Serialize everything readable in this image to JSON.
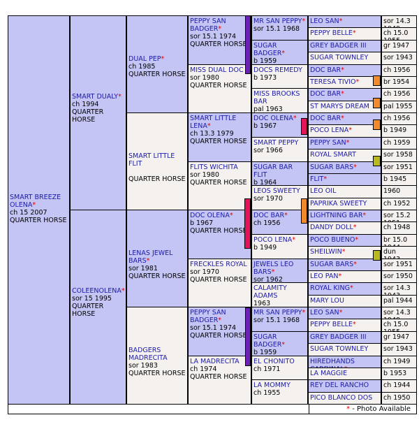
{
  "marker_colors": {
    "purple": "#6e1fb5",
    "red": "#e2145a",
    "orange": "#f08a2c",
    "olive": "#b8b820"
  },
  "footer": {
    "star": "*",
    "legend": " - Photo Available"
  },
  "gen1": {
    "name": "SMART BREEZE OLENA",
    "star": "*",
    "line1": "ch 15 2007",
    "line2": "QUARTER HORSE"
  },
  "gen2": [
    {
      "name": "SMART DUALY",
      "star": "*",
      "line1": "ch 1994",
      "line2": "QUARTER HORSE"
    },
    {
      "name": "COLEENOLENA",
      "star": "*",
      "line1": "sor 15 1995",
      "line2": "QUARTER HORSE"
    }
  ],
  "gen3": [
    {
      "name": "DUAL PEP",
      "star": "*",
      "line1": "ch 1985",
      "line2": "QUARTER HORSE"
    },
    {
      "name": "SMART LITTLE FLIT",
      "star": "",
      "line1": "",
      "line2": "QUARTER HORSE"
    },
    {
      "name": "LENAS JEWEL BARS",
      "star": "*",
      "line1": "sor 1981",
      "line2": "QUARTER HORSE"
    },
    {
      "name": "BADGERS MADRECITA",
      "star": "",
      "line1": "sor 1983",
      "line2": "QUARTER HORSE"
    }
  ],
  "gen4": [
    {
      "name": "PEPPY SAN BADGER",
      "star": "*",
      "line1": "sor 15.1 1974",
      "line2": "QUARTER HORSE"
    },
    {
      "name": "MISS DUAL DOC",
      "star": "",
      "line1": "sor 1980",
      "line2": "QUARTER HORSE"
    },
    {
      "name": "SMART LITTLE LENA",
      "star": "*",
      "line1": "ch 13.3 1979",
      "line2": "QUARTER HORSE"
    },
    {
      "name": "FLITS WICHITA",
      "star": "",
      "line1": "sor 1980",
      "line2": "QUARTER HORSE"
    },
    {
      "name": "DOC OLENA",
      "star": "*",
      "line1": "b 1967",
      "line2": "QUARTER HORSE"
    },
    {
      "name": "FRECKLES ROYAL",
      "star": "",
      "line1": "sor 1970",
      "line2": "QUARTER HORSE"
    },
    {
      "name": "PEPPY SAN BADGER",
      "star": "*",
      "line1": "sor 15.1 1974",
      "line2": "QUARTER HORSE"
    },
    {
      "name": "LA MADRECITA",
      "star": "",
      "line1": "ch 1974",
      "line2": "QUARTER HORSE"
    }
  ],
  "gen5": [
    {
      "name": "MR SAN PEPPY",
      "star": "*",
      "line1": "sor 15.1 1968"
    },
    {
      "name": "SUGAR BADGER",
      "star": "*",
      "line1": "b 1959"
    },
    {
      "name": "DOCS REMEDY",
      "star": "",
      "line1": "b 1973"
    },
    {
      "name": "MISS BROOKS BAR",
      "star": "",
      "line1": "pal 1963"
    },
    {
      "name": "DOC OLENA",
      "star": "*",
      "line1": "b 1967"
    },
    {
      "name": "SMART PEPPY",
      "star": "",
      "line1": "sor 1966"
    },
    {
      "name": "SUGAR BAR FLIT",
      "star": "",
      "line1": "b 1964"
    },
    {
      "name": "LEOS SWEETY",
      "star": "",
      "line1": "sor 1970"
    },
    {
      "name": "DOC BAR",
      "star": "*",
      "line1": "ch 1956"
    },
    {
      "name": "POCO LENA",
      "star": "*",
      "line1": "b 1949"
    },
    {
      "name": "JEWELS LEO BARS",
      "star": "*",
      "line1": "sor 1962"
    },
    {
      "name": "CALAMITY ADAMS",
      "star": "",
      "line1": "1963"
    },
    {
      "name": "MR SAN PEPPY",
      "star": "*",
      "line1": "sor 15.1 1968"
    },
    {
      "name": "SUGAR BADGER",
      "star": "*",
      "line1": "b 1959"
    },
    {
      "name": "EL CHONITO",
      "star": "",
      "line1": "ch 1971"
    },
    {
      "name": "LA MOMMY",
      "star": "",
      "line1": "ch 1955"
    }
  ],
  "gen6": [
    {
      "name": "LEO SAN",
      "star": "*",
      "info": "sor 14.3 1949"
    },
    {
      "name": "PEPPY BELLE",
      "star": "*",
      "info": "ch 15.0 1955"
    },
    {
      "name": "GREY BADGER III",
      "star": "",
      "info": "gr 1947"
    },
    {
      "name": "SUGAR TOWNLEY",
      "star": "",
      "info": "sor 1943"
    },
    {
      "name": "DOC BAR",
      "star": "*",
      "info": "ch 1956"
    },
    {
      "name": "TERESA TIVIO",
      "star": "*",
      "info": "br 1954"
    },
    {
      "name": "DOC BAR",
      "star": "*",
      "info": "ch 1956"
    },
    {
      "name": "ST MARYS DREAM",
      "star": "",
      "info": "pal 1955"
    },
    {
      "name": "DOC BAR",
      "star": "*",
      "info": "ch 1956"
    },
    {
      "name": "POCO LENA",
      "star": "*",
      "info": "b 1949"
    },
    {
      "name": "PEPPY SAN",
      "star": "*",
      "info": "ch 1959"
    },
    {
      "name": "ROYAL SMART",
      "star": "",
      "info": "sor 1958"
    },
    {
      "name": "SUGAR BARS",
      "star": "*",
      "info": "sor 1951"
    },
    {
      "name": "FLIT",
      "star": "*",
      "info": "b 1945"
    },
    {
      "name": "LEO OIL",
      "star": "",
      "info": "1960"
    },
    {
      "name": "PAPRIKA SWEETY",
      "star": "",
      "info": "ch 1952"
    },
    {
      "name": "LIGHTNING BAR",
      "star": "*",
      "info": "sor 15.2 1951"
    },
    {
      "name": "DANDY DOLL",
      "star": "*",
      "info": "ch 1948"
    },
    {
      "name": "POCO BUENO",
      "star": "*",
      "info": "br 15.0 1944"
    },
    {
      "name": "SHEILWIN",
      "star": "*",
      "info": "dun 1943"
    },
    {
      "name": "SUGAR BARS",
      "star": "*",
      "info": "sor 1951"
    },
    {
      "name": "LEO PAN",
      "star": "*",
      "info": "sor 1950"
    },
    {
      "name": "ROYAL KING",
      "star": "*",
      "info": "sor 14.3 1943"
    },
    {
      "name": "MARY LOU",
      "star": "",
      "info": "pal 1944"
    },
    {
      "name": "LEO SAN",
      "star": "*",
      "info": "sor 14.3 1949"
    },
    {
      "name": "PEPPY BELLE",
      "star": "*",
      "info": "ch 15.0 1955"
    },
    {
      "name": "GREY BADGER III",
      "star": "",
      "info": "gr 1947"
    },
    {
      "name": "SUGAR TOWNLEY",
      "star": "",
      "info": "sor 1943"
    },
    {
      "name": "HIREDHANDS CARDINAL",
      "star": "*",
      "info": "ch 1949"
    },
    {
      "name": "LA MAGGIE",
      "star": "",
      "info": "b 1953"
    },
    {
      "name": "REY DEL RANCHO",
      "star": "",
      "info": "ch 1944"
    },
    {
      "name": "PICO BLANCO DOS",
      "star": "",
      "info": "ch 1950"
    }
  ]
}
